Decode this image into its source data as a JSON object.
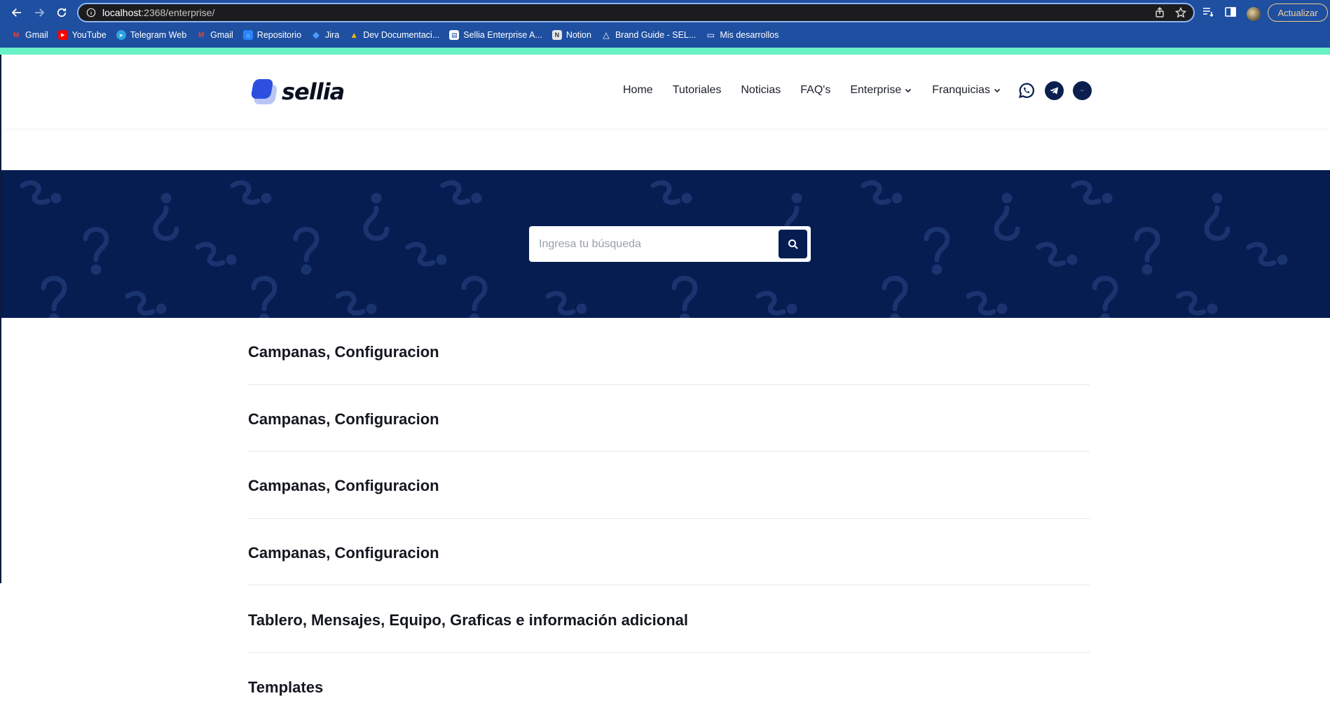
{
  "browser": {
    "url_host": "localhost",
    "url_rest": ":2368/enterprise/",
    "update_label": "Actualizar",
    "bookmarks": [
      {
        "label": "Gmail",
        "icon": "gmail-icon"
      },
      {
        "label": "YouTube",
        "icon": "youtube-icon"
      },
      {
        "label": "Telegram Web",
        "icon": "telegram-icon"
      },
      {
        "label": "Gmail",
        "icon": "gmail-icon"
      },
      {
        "label": "Repositorio",
        "icon": "repo-icon"
      },
      {
        "label": "Jira",
        "icon": "jira-icon"
      },
      {
        "label": "Dev Documentaci...",
        "icon": "drive-icon"
      },
      {
        "label": "Sellia Enterprise A...",
        "icon": "doc-icon"
      },
      {
        "label": "Notion",
        "icon": "notion-icon"
      },
      {
        "label": "Brand Guide - SEL...",
        "icon": "triangle-icon"
      },
      {
        "label": "Mis desarrollos",
        "icon": "folder-icon"
      }
    ]
  },
  "site": {
    "logo_text": "sellia",
    "nav": [
      {
        "label": "Home",
        "dropdown": false
      },
      {
        "label": "Tutoriales",
        "dropdown": false
      },
      {
        "label": "Noticias",
        "dropdown": false
      },
      {
        "label": "FAQ's",
        "dropdown": false
      },
      {
        "label": "Enterprise",
        "dropdown": true
      },
      {
        "label": "Franquicias",
        "dropdown": true
      }
    ],
    "social": [
      "whatsapp-icon",
      "telegram-icon",
      "messenger-icon"
    ]
  },
  "hero": {
    "search_placeholder": "Ingresa tu búsqueda"
  },
  "articles": [
    "Campanas, Configuracion",
    "Campanas, Configuracion",
    "Campanas, Configuracion",
    "Campanas, Configuracion",
    "Tablero, Mensajes, Equipo, Graficas e información adicional",
    "Templates"
  ],
  "colors": {
    "chrome": "#1e4fa0",
    "accent_line": "#6af2c6",
    "navy": "#061d52",
    "logo_blue": "#2d4fe0"
  }
}
